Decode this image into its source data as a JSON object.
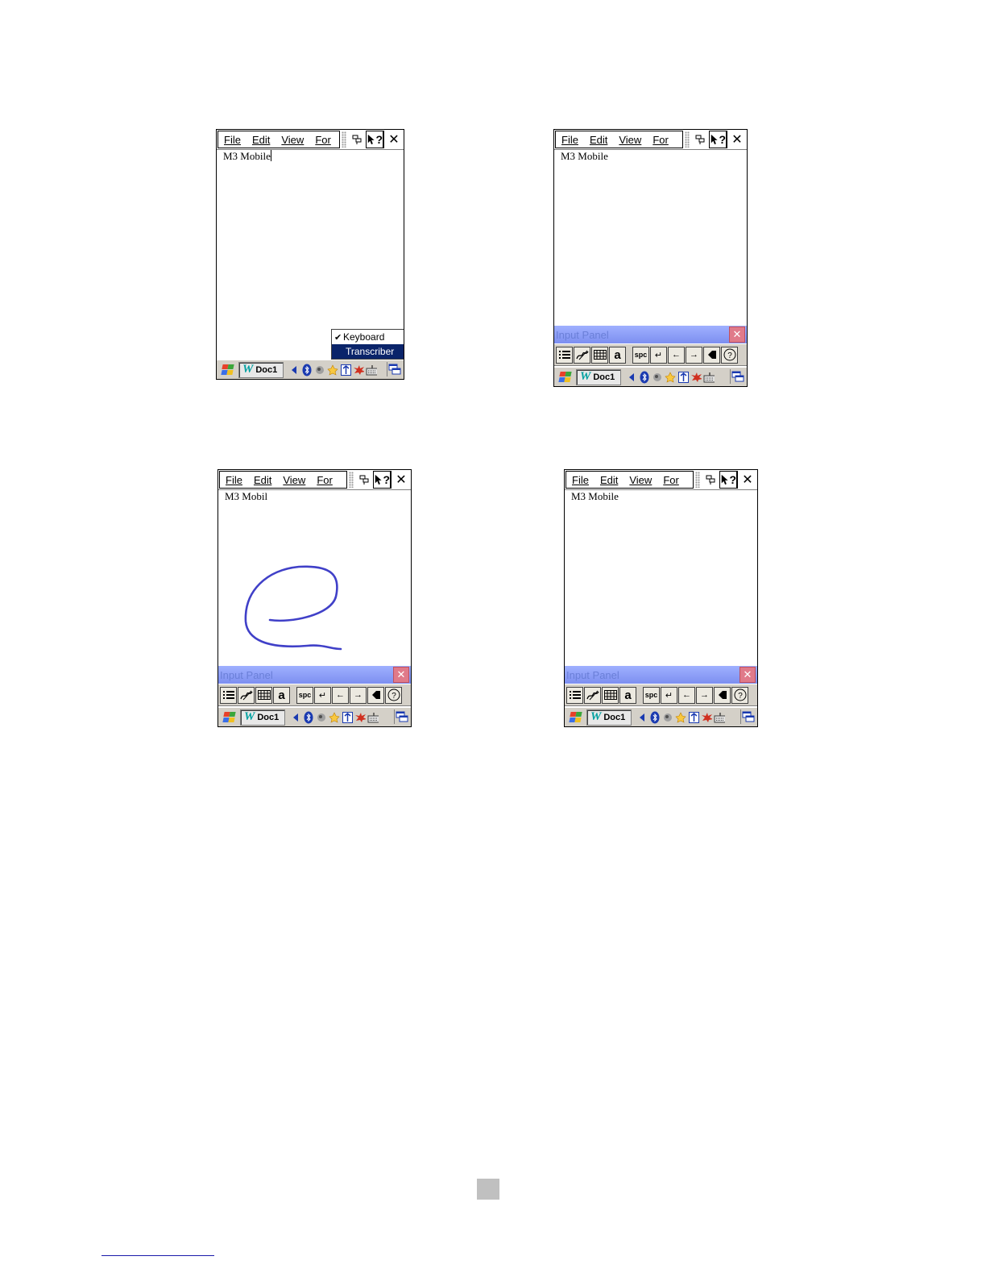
{
  "menu": {
    "file": "File",
    "edit": "Edit",
    "view": "View",
    "format": "For"
  },
  "close_label": "✕",
  "help_label": "?",
  "document_texts": [
    "M3 Mobile",
    "M3 Mobile",
    "M3 Mobil",
    "M3 Mobile"
  ],
  "taskbar": {
    "task_label": "Doc1",
    "task_app_letter": "W"
  },
  "input_method_menu": {
    "items": [
      "Keyboard",
      "Transcriber"
    ],
    "checked": "Keyboard",
    "selected": "Transcriber"
  },
  "input_panel": {
    "title": "Input Panel",
    "close": "✕",
    "buttons": {
      "space": "spc",
      "enter": "↵",
      "left": "←",
      "right": "→",
      "backspace": "◆",
      "help": "?",
      "letter": "a"
    }
  },
  "colors": {
    "ink": "#4040c8",
    "input_panel_title": "#8b9cf7",
    "selection": "#0a246a"
  }
}
